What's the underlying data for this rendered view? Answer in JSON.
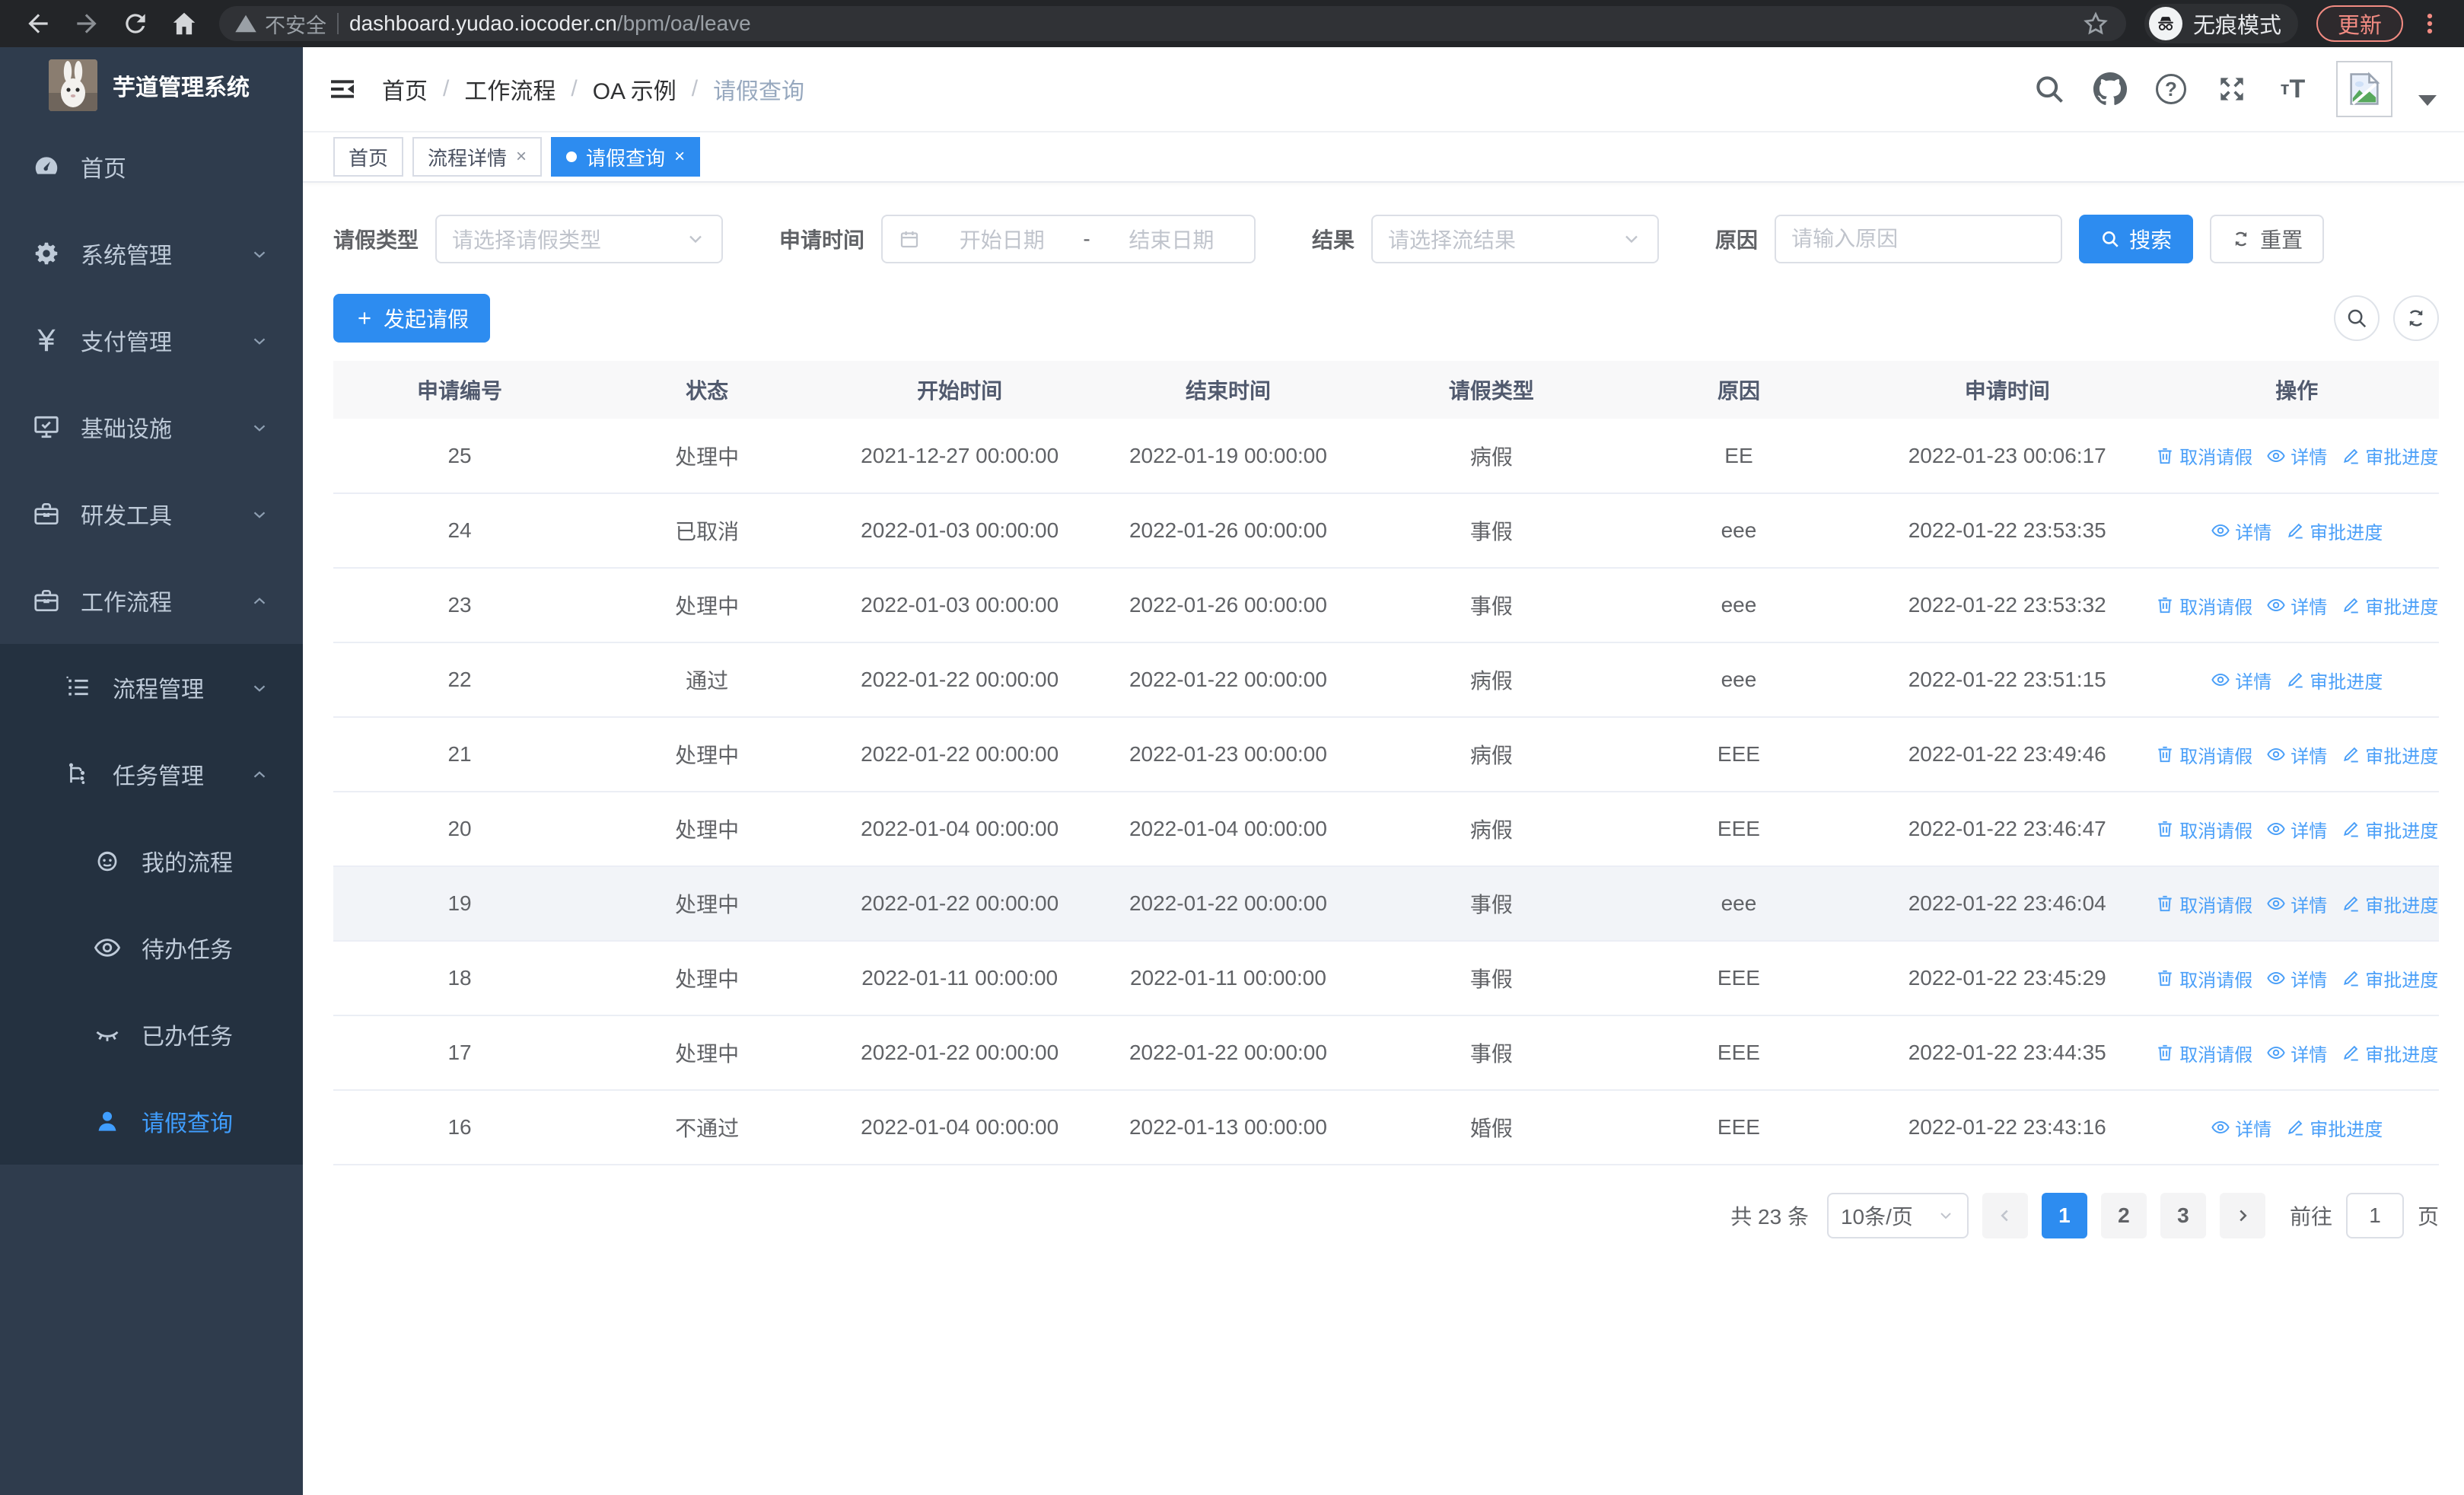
{
  "browser": {
    "security_label": "不安全",
    "url_host": "dashboard.yudao.iocoder.cn",
    "url_path": "/bpm/oa/leave",
    "incognito_label": "无痕模式",
    "update_label": "更新"
  },
  "sidebar": {
    "app_title": "芋道管理系统",
    "items": [
      {
        "label": "首页",
        "icon": "dashboard-icon",
        "level": 1,
        "chevron": "",
        "sub": false,
        "active": false
      },
      {
        "label": "系统管理",
        "icon": "gear-icon",
        "level": 1,
        "chevron": "down",
        "sub": false,
        "active": false
      },
      {
        "label": "支付管理",
        "icon": "yen-icon",
        "level": 1,
        "chevron": "down",
        "sub": false,
        "active": false
      },
      {
        "label": "基础设施",
        "icon": "monitor-icon",
        "level": 1,
        "chevron": "down",
        "sub": false,
        "active": false
      },
      {
        "label": "研发工具",
        "icon": "toolbox-icon",
        "level": 1,
        "chevron": "down",
        "sub": false,
        "active": false
      },
      {
        "label": "工作流程",
        "icon": "briefcase-icon",
        "level": 1,
        "chevron": "up",
        "sub": false,
        "active": false
      },
      {
        "label": "流程管理",
        "icon": "list-tree-icon",
        "level": 2,
        "chevron": "down",
        "sub": true,
        "active": false
      },
      {
        "label": "任务管理",
        "icon": "flow-icon",
        "level": 2,
        "chevron": "up",
        "sub": true,
        "active": false
      },
      {
        "label": "我的流程",
        "icon": "face-icon",
        "level": 3,
        "chevron": "",
        "sub": true,
        "active": false
      },
      {
        "label": "待办任务",
        "icon": "eye-open-icon",
        "level": 3,
        "chevron": "",
        "sub": true,
        "active": false
      },
      {
        "label": "已办任务",
        "icon": "eye-closed-icon",
        "level": 3,
        "chevron": "",
        "sub": true,
        "active": false
      },
      {
        "label": "请假查询",
        "icon": "user-icon",
        "level": 3,
        "chevron": "",
        "sub": true,
        "active": true
      }
    ]
  },
  "header": {
    "breadcrumb": [
      "首页",
      "工作流程",
      "OA 示例",
      "请假查询"
    ]
  },
  "tabs": [
    {
      "label": "首页",
      "closable": false,
      "active": false
    },
    {
      "label": "流程详情",
      "closable": true,
      "active": false
    },
    {
      "label": "请假查询",
      "closable": true,
      "active": true
    }
  ],
  "filters": {
    "leave_type_label": "请假类型",
    "leave_type_placeholder": "请选择请假类型",
    "apply_time_label": "申请时间",
    "date_start_placeholder": "开始日期",
    "date_separator": "-",
    "date_end_placeholder": "结束日期",
    "result_label": "结果",
    "result_placeholder": "请选择流结果",
    "reason_label": "原因",
    "reason_placeholder": "请输入原因",
    "search_label": "搜索",
    "reset_label": "重置"
  },
  "toolbar": {
    "create_label": "发起请假"
  },
  "table": {
    "columns": [
      "申请编号",
      "状态",
      "开始时间",
      "结束时间",
      "请假类型",
      "原因",
      "申请时间",
      "操作"
    ],
    "action_labels": {
      "cancel": "取消请假",
      "detail": "详情",
      "progress": "审批进度"
    },
    "rows": [
      {
        "id": "25",
        "status": "处理中",
        "start": "2021-12-27 00:00:00",
        "end": "2022-01-19 00:00:00",
        "type": "病假",
        "reason": "EE",
        "apply_time": "2022-01-23 00:06:17",
        "cancelable": true,
        "highlighted": false
      },
      {
        "id": "24",
        "status": "已取消",
        "start": "2022-01-03 00:00:00",
        "end": "2022-01-26 00:00:00",
        "type": "事假",
        "reason": "eee",
        "apply_time": "2022-01-22 23:53:35",
        "cancelable": false,
        "highlighted": false
      },
      {
        "id": "23",
        "status": "处理中",
        "start": "2022-01-03 00:00:00",
        "end": "2022-01-26 00:00:00",
        "type": "事假",
        "reason": "eee",
        "apply_time": "2022-01-22 23:53:32",
        "cancelable": true,
        "highlighted": false
      },
      {
        "id": "22",
        "status": "通过",
        "start": "2022-01-22 00:00:00",
        "end": "2022-01-22 00:00:00",
        "type": "病假",
        "reason": "eee",
        "apply_time": "2022-01-22 23:51:15",
        "cancelable": false,
        "highlighted": false
      },
      {
        "id": "21",
        "status": "处理中",
        "start": "2022-01-22 00:00:00",
        "end": "2022-01-23 00:00:00",
        "type": "病假",
        "reason": "EEE",
        "apply_time": "2022-01-22 23:49:46",
        "cancelable": true,
        "highlighted": false
      },
      {
        "id": "20",
        "status": "处理中",
        "start": "2022-01-04 00:00:00",
        "end": "2022-01-04 00:00:00",
        "type": "病假",
        "reason": "EEE",
        "apply_time": "2022-01-22 23:46:47",
        "cancelable": true,
        "highlighted": false
      },
      {
        "id": "19",
        "status": "处理中",
        "start": "2022-01-22 00:00:00",
        "end": "2022-01-22 00:00:00",
        "type": "事假",
        "reason": "eee",
        "apply_time": "2022-01-22 23:46:04",
        "cancelable": true,
        "highlighted": true
      },
      {
        "id": "18",
        "status": "处理中",
        "start": "2022-01-11 00:00:00",
        "end": "2022-01-11 00:00:00",
        "type": "事假",
        "reason": "EEE",
        "apply_time": "2022-01-22 23:45:29",
        "cancelable": true,
        "highlighted": false
      },
      {
        "id": "17",
        "status": "处理中",
        "start": "2022-01-22 00:00:00",
        "end": "2022-01-22 00:00:00",
        "type": "事假",
        "reason": "EEE",
        "apply_time": "2022-01-22 23:44:35",
        "cancelable": true,
        "highlighted": false
      },
      {
        "id": "16",
        "status": "不通过",
        "start": "2022-01-04 00:00:00",
        "end": "2022-01-13 00:00:00",
        "type": "婚假",
        "reason": "EEE",
        "apply_time": "2022-01-22 23:43:16",
        "cancelable": false,
        "highlighted": false
      }
    ]
  },
  "pagination": {
    "total_label": "共 23 条",
    "page_size": "10条/页",
    "pages": [
      "1",
      "2",
      "3"
    ],
    "current": "1",
    "goto_label": "前往",
    "goto_value": "1",
    "goto_unit": "页"
  }
}
